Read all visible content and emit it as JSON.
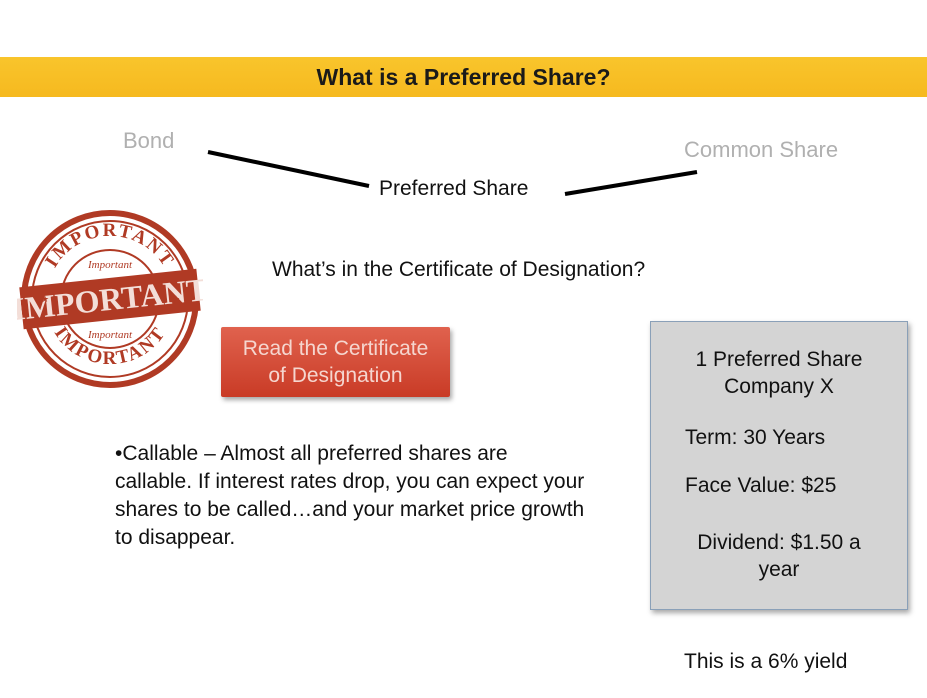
{
  "slide": {
    "title": "What is a Preferred Share?",
    "spectrum": {
      "left": "Bond",
      "middle": "Preferred Share",
      "right": "Common Share"
    },
    "question": "What’s in the Certificate of Designation?",
    "button": {
      "line1": "Read the Certificate",
      "line2": "of Designation"
    },
    "stamp": {
      "main": "IMPORTANT",
      "small": "Important",
      "color": "#b03a24"
    },
    "callable": "•Callable – Almost all preferred shares are callable.  If interest rates drop, you can expect your shares to be called…and your market price growth to disappear.",
    "card": {
      "line1": "1 Preferred Share",
      "line2": "Company X",
      "term": "Term: 30 Years",
      "face_value": "Face Value: $25",
      "dividend_line1": "Dividend: $1.50 a",
      "dividend_line2": "year"
    },
    "yield_note": "This is a 6% yield"
  },
  "colors": {
    "title_bar": "#f7be25",
    "button": "#d24c36",
    "card": "#d4d4d4"
  }
}
